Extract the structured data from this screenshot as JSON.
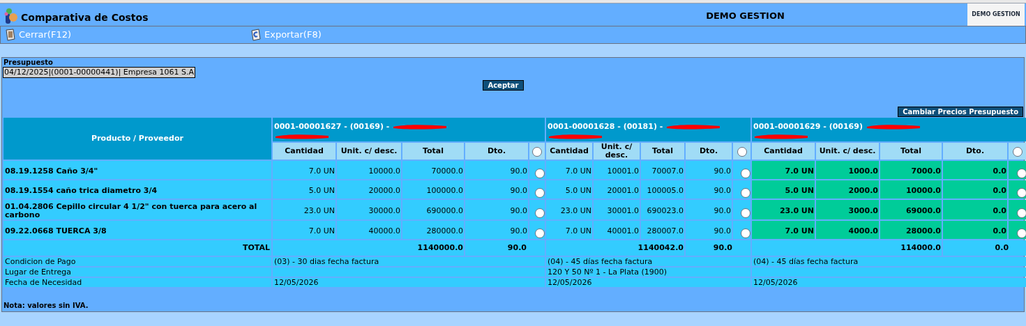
{
  "window": {
    "title": "Comparativa de Costos",
    "app_name": "DEMO GESTION",
    "logo_text": "DEMO GESTION"
  },
  "toolbar": [
    {
      "label": "Cerrar(F12)",
      "kind": "close"
    },
    {
      "label": "Exportar(F8)",
      "kind": "export"
    }
  ],
  "presupuesto": {
    "label": "Presupuesto",
    "value": "04/12/2025|(0001-00000441)| Empresa 1061 S.A"
  },
  "accept_button": "Aceptar",
  "change_prices_button": "Cambiar Precios Presupuesto",
  "table": {
    "product_header": "Producto / Proveedor",
    "total_label": "TOTAL",
    "products": [
      "08.19.1258 Caño 3/4\"",
      "08.19.1554 caño trica diametro 3/4",
      "01.04.2806 Cepillo circular 4 1/2\" con tuerca para acero al carbono",
      "09.22.0668 TUERCA 3/8"
    ],
    "suppliers": [
      {
        "title": "0001-00001627 - (00169) -",
        "columns": [
          "Cantidad",
          "Unit. c/ desc.",
          "Total",
          "Dto."
        ],
        "selected": false,
        "checked": false,
        "total": "1140000.0",
        "discount": "90.0",
        "rows": [
          {
            "qty": "7.0 UN",
            "unit": "10000.0",
            "total": "70000.0",
            "dto": "90.0",
            "checked": false
          },
          {
            "qty": "5.0 UN",
            "unit": "20000.0",
            "total": "100000.0",
            "dto": "90.0",
            "checked": false
          },
          {
            "qty": "23.0 UN",
            "unit": "30000.0",
            "total": "690000.0",
            "dto": "90.0",
            "checked": false
          },
          {
            "qty": "7.0 UN",
            "unit": "40000.0",
            "total": "280000.0",
            "dto": "90.0",
            "checked": false
          }
        ],
        "payment": "(03) - 30 dias fecha factura",
        "date": "12/05/2026"
      },
      {
        "title": "0001-00001628 - (00181) -",
        "columns": [
          "Cantidad",
          "Unit. c/ desc.",
          "Total",
          "Dto."
        ],
        "selected": false,
        "checked": false,
        "total": "1140042.0",
        "discount": "90.0",
        "rows": [
          {
            "qty": "7.0 UN",
            "unit": "10001.0",
            "total": "70007.0",
            "dto": "90.0",
            "checked": false
          },
          {
            "qty": "5.0 UN",
            "unit": "20001.0",
            "total": "100005.0",
            "dto": "90.0",
            "checked": false
          },
          {
            "qty": "23.0 UN",
            "unit": "30001.0",
            "total": "690023.0",
            "dto": "90.0",
            "checked": false
          },
          {
            "qty": "7.0 UN",
            "unit": "40001.0",
            "total": "280007.0",
            "dto": "90.0",
            "checked": false
          }
        ],
        "payment": "(04) - 45 días fecha factura",
        "delivery": "120 Y 50 Nº 1 - La Plata (1900)",
        "date": "12/05/2026"
      },
      {
        "title": "0001-00001629 - (00169)",
        "columns": [
          "Cantidad",
          "Unit. c/ desc.",
          "Total",
          "Dto."
        ],
        "selected": true,
        "checked": false,
        "total": "114000.0",
        "discount": "0.0",
        "rows": [
          {
            "qty": "7.0 UN",
            "unit": "1000.0",
            "total": "7000.0",
            "dto": "0.0",
            "checked": false
          },
          {
            "qty": "5.0 UN",
            "unit": "2000.0",
            "total": "10000.0",
            "dto": "0.0",
            "checked": false
          },
          {
            "qty": "23.0 UN",
            "unit": "3000.0",
            "total": "69000.0",
            "dto": "0.0",
            "checked": false
          },
          {
            "qty": "7.0 UN",
            "unit": "4000.0",
            "total": "28000.0",
            "dto": "0.0",
            "checked": false
          }
        ],
        "payment": "(04) - 45 días fecha factura",
        "date": "12/05/2026"
      }
    ],
    "info_labels": [
      "Condicion de Pago",
      "Lugar de Entrega",
      "Fecha de Necesidad"
    ]
  },
  "note": "Nota: valores sin IVA."
}
